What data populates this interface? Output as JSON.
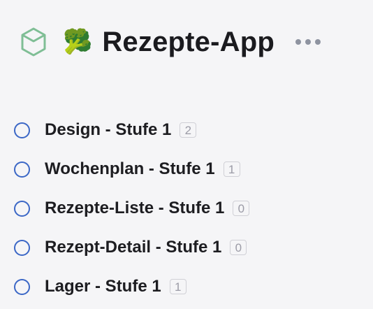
{
  "header": {
    "icon": "box-icon",
    "emoji": "🥦",
    "title": "Rezepte-App",
    "more_icon": "more-horizontal-icon"
  },
  "tasks": [
    {
      "label": "Design - Stufe 1",
      "count": "2"
    },
    {
      "label": "Wochenplan - Stufe 1",
      "count": "1"
    },
    {
      "label": "Rezepte-Liste - Stufe 1",
      "count": "0"
    },
    {
      "label": "Rezept-Detail - Stufe 1",
      "count": "0"
    },
    {
      "label": "Lager - Stufe 1",
      "count": "1"
    }
  ],
  "colors": {
    "background": "#f5f5f7",
    "project_icon": "#7fbe95",
    "checkbox": "#3b67c6",
    "text": "#1d1d21"
  }
}
